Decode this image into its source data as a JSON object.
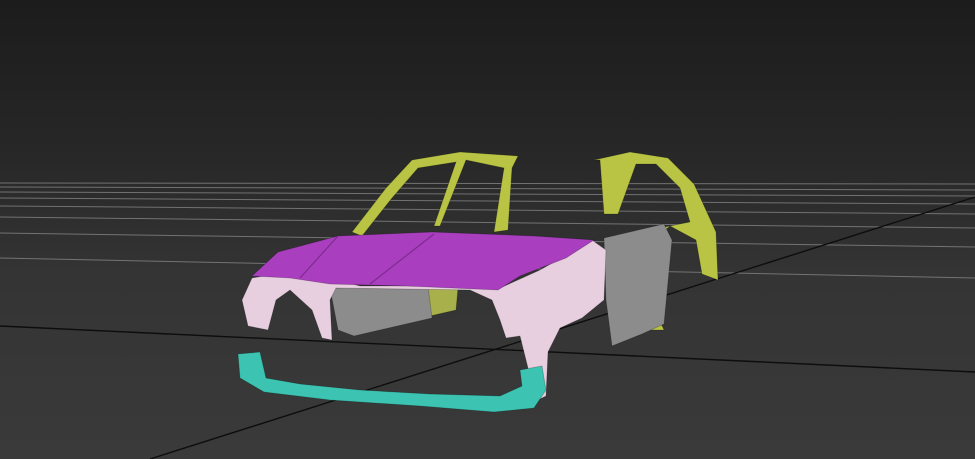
{
  "viewport": {
    "background_top": "#1c1c1c",
    "background_bottom": "#3a3a3a",
    "grid_color": "#8f8f8f",
    "axis_color": "#0d0d0d"
  },
  "model": {
    "part_colors": {
      "hood": "#a93fbf",
      "front_fender_shell": "#e8cfe0",
      "front_bumper": "#3cc3b1",
      "door_frame_left": "#b9c444",
      "door_frame_right": "#b9c444",
      "door_panel": "#8c8c8c",
      "inner_sheet": "#a7b04a"
    }
  }
}
